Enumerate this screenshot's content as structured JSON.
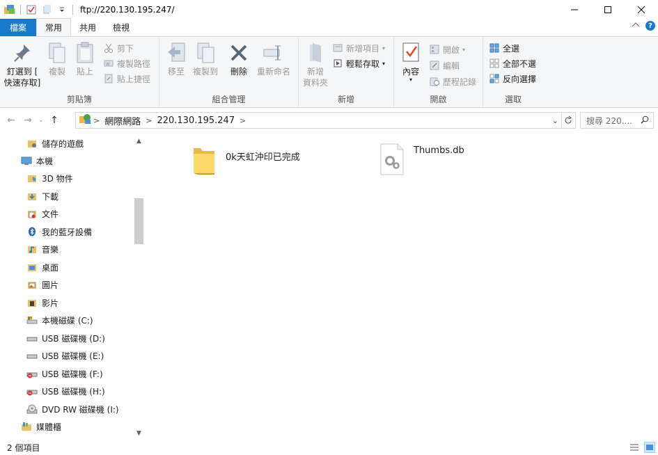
{
  "window": {
    "title": "ftp://220.130.195.247/",
    "controls": [
      "minimize",
      "maximize",
      "close"
    ]
  },
  "ribbon_tabs": [
    {
      "label": "檔案"
    },
    {
      "label": "常用"
    },
    {
      "label": "共用"
    },
    {
      "label": "檢視"
    }
  ],
  "ribbon": {
    "clipboard": {
      "label": "剪貼簿",
      "pin_line1": "釘選到 [",
      "pin_line2": "快速存取]",
      "copy": "複製",
      "paste": "貼上",
      "cut": "剪下",
      "copy_path": "複製路徑",
      "paste_shortcut": "貼上捷徑"
    },
    "organize": {
      "label": "組合管理",
      "move_to": "移至",
      "copy_to": "複製到",
      "delete": "刪除",
      "rename": "重新命名"
    },
    "new": {
      "label": "新增",
      "new_folder_line1": "新增",
      "new_folder_line2": "資料夾",
      "new_item": "新增項目",
      "easy_access": "輕鬆存取"
    },
    "open": {
      "label": "開啟",
      "properties": "內容",
      "open": "開啟",
      "edit": "編輯",
      "history": "歷程記錄"
    },
    "select": {
      "label": "選取",
      "select_all": "全選",
      "select_none": "全部不選",
      "invert": "反向選擇"
    }
  },
  "address": {
    "crumbs": [
      "網際網路",
      "220.130.195.247"
    ],
    "search_placeholder": "搜尋 220...."
  },
  "nav_pane": [
    {
      "label": "儲存的遊戲",
      "icon": "saved-games-icon"
    },
    {
      "label": "本機",
      "icon": "this-pc-icon"
    },
    {
      "label": "3D 物件",
      "icon": "3d-objects-icon"
    },
    {
      "label": "下載",
      "icon": "downloads-icon"
    },
    {
      "label": "文件",
      "icon": "documents-icon"
    },
    {
      "label": "我的藍牙設備",
      "icon": "bluetooth-icon"
    },
    {
      "label": "音樂",
      "icon": "music-icon"
    },
    {
      "label": "桌面",
      "icon": "desktop-icon"
    },
    {
      "label": "圖片",
      "icon": "pictures-icon"
    },
    {
      "label": "影片",
      "icon": "videos-icon"
    },
    {
      "label": "本機磁碟 (C:)",
      "icon": "local-disk-icon"
    },
    {
      "label": "USB 磁碟機 (D:)",
      "icon": "usb-drive-icon"
    },
    {
      "label": "USB 磁碟機 (E:)",
      "icon": "usb-drive-icon"
    },
    {
      "label": "USB 磁碟機 (F:)",
      "icon": "usb-drive-error-icon"
    },
    {
      "label": "USB 磁碟機 (H:)",
      "icon": "usb-drive-error-icon"
    },
    {
      "label": "DVD RW 磁碟機 (I:)",
      "icon": "dvd-drive-icon"
    },
    {
      "label": "媒體櫃",
      "icon": "libraries-icon"
    }
  ],
  "files": [
    {
      "name": "0k天虹沖印已完成",
      "type": "folder"
    },
    {
      "name": "Thumbs.db",
      "type": "system-file"
    }
  ],
  "status": {
    "item_count": "2 個項目"
  }
}
